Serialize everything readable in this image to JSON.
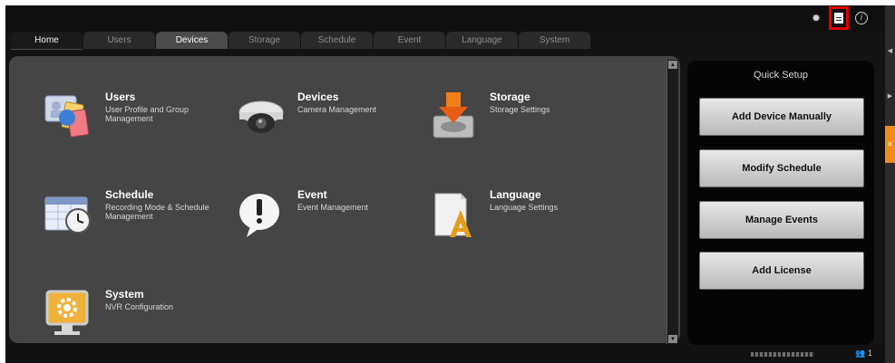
{
  "tabs": [
    "Home",
    "Users",
    "Devices",
    "Storage",
    "Schedule",
    "Event",
    "Language",
    "System"
  ],
  "tiles": [
    {
      "title": "Users",
      "desc": "User Profile and Group Management",
      "icon": "users-icon"
    },
    {
      "title": "Devices",
      "desc": "Camera Management",
      "icon": "camera-icon"
    },
    {
      "title": "Storage",
      "desc": "Storage Settings",
      "icon": "storage-icon"
    },
    {
      "title": "Schedule",
      "desc": "Recording Mode & Schedule Management",
      "icon": "schedule-icon"
    },
    {
      "title": "Event",
      "desc": "Event Management",
      "icon": "event-icon"
    },
    {
      "title": "Language",
      "desc": "Language Settings",
      "icon": "language-icon"
    },
    {
      "title": "System",
      "desc": "NVR Configuration",
      "icon": "system-icon"
    }
  ],
  "quick_setup": {
    "title": "Quick Setup",
    "buttons": [
      "Add Device Manually",
      "Modify Schedule",
      "Manage Events",
      "Add License"
    ]
  },
  "status": {
    "count": "1"
  },
  "colors": {
    "highlight": "#e00000",
    "accent": "#f08a1a",
    "panel": "#454545"
  }
}
